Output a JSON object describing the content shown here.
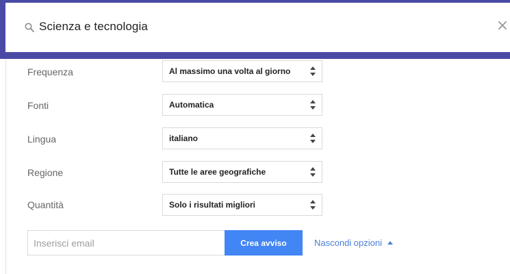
{
  "search": {
    "query": "Scienza e tecnologia",
    "icon": "search-icon",
    "close_icon": "close-icon"
  },
  "options": [
    {
      "label": "Frequenza",
      "value": "Al massimo una volta al giorno"
    },
    {
      "label": "Fonti",
      "value": "Automatica"
    },
    {
      "label": "Lingua",
      "value": "italiano"
    },
    {
      "label": "Regione",
      "value": "Tutte le aree geografiche"
    },
    {
      "label": "Quantità",
      "value": "Solo i risultati migliori"
    }
  ],
  "footer": {
    "email_placeholder": "Inserisci email",
    "create_button_label": "Crea avviso",
    "hide_options_label": "Nascondi opzioni"
  },
  "colors": {
    "accent_bar": "#4a4aa6",
    "button": "#4285f4",
    "link": "#4a7fd8"
  }
}
